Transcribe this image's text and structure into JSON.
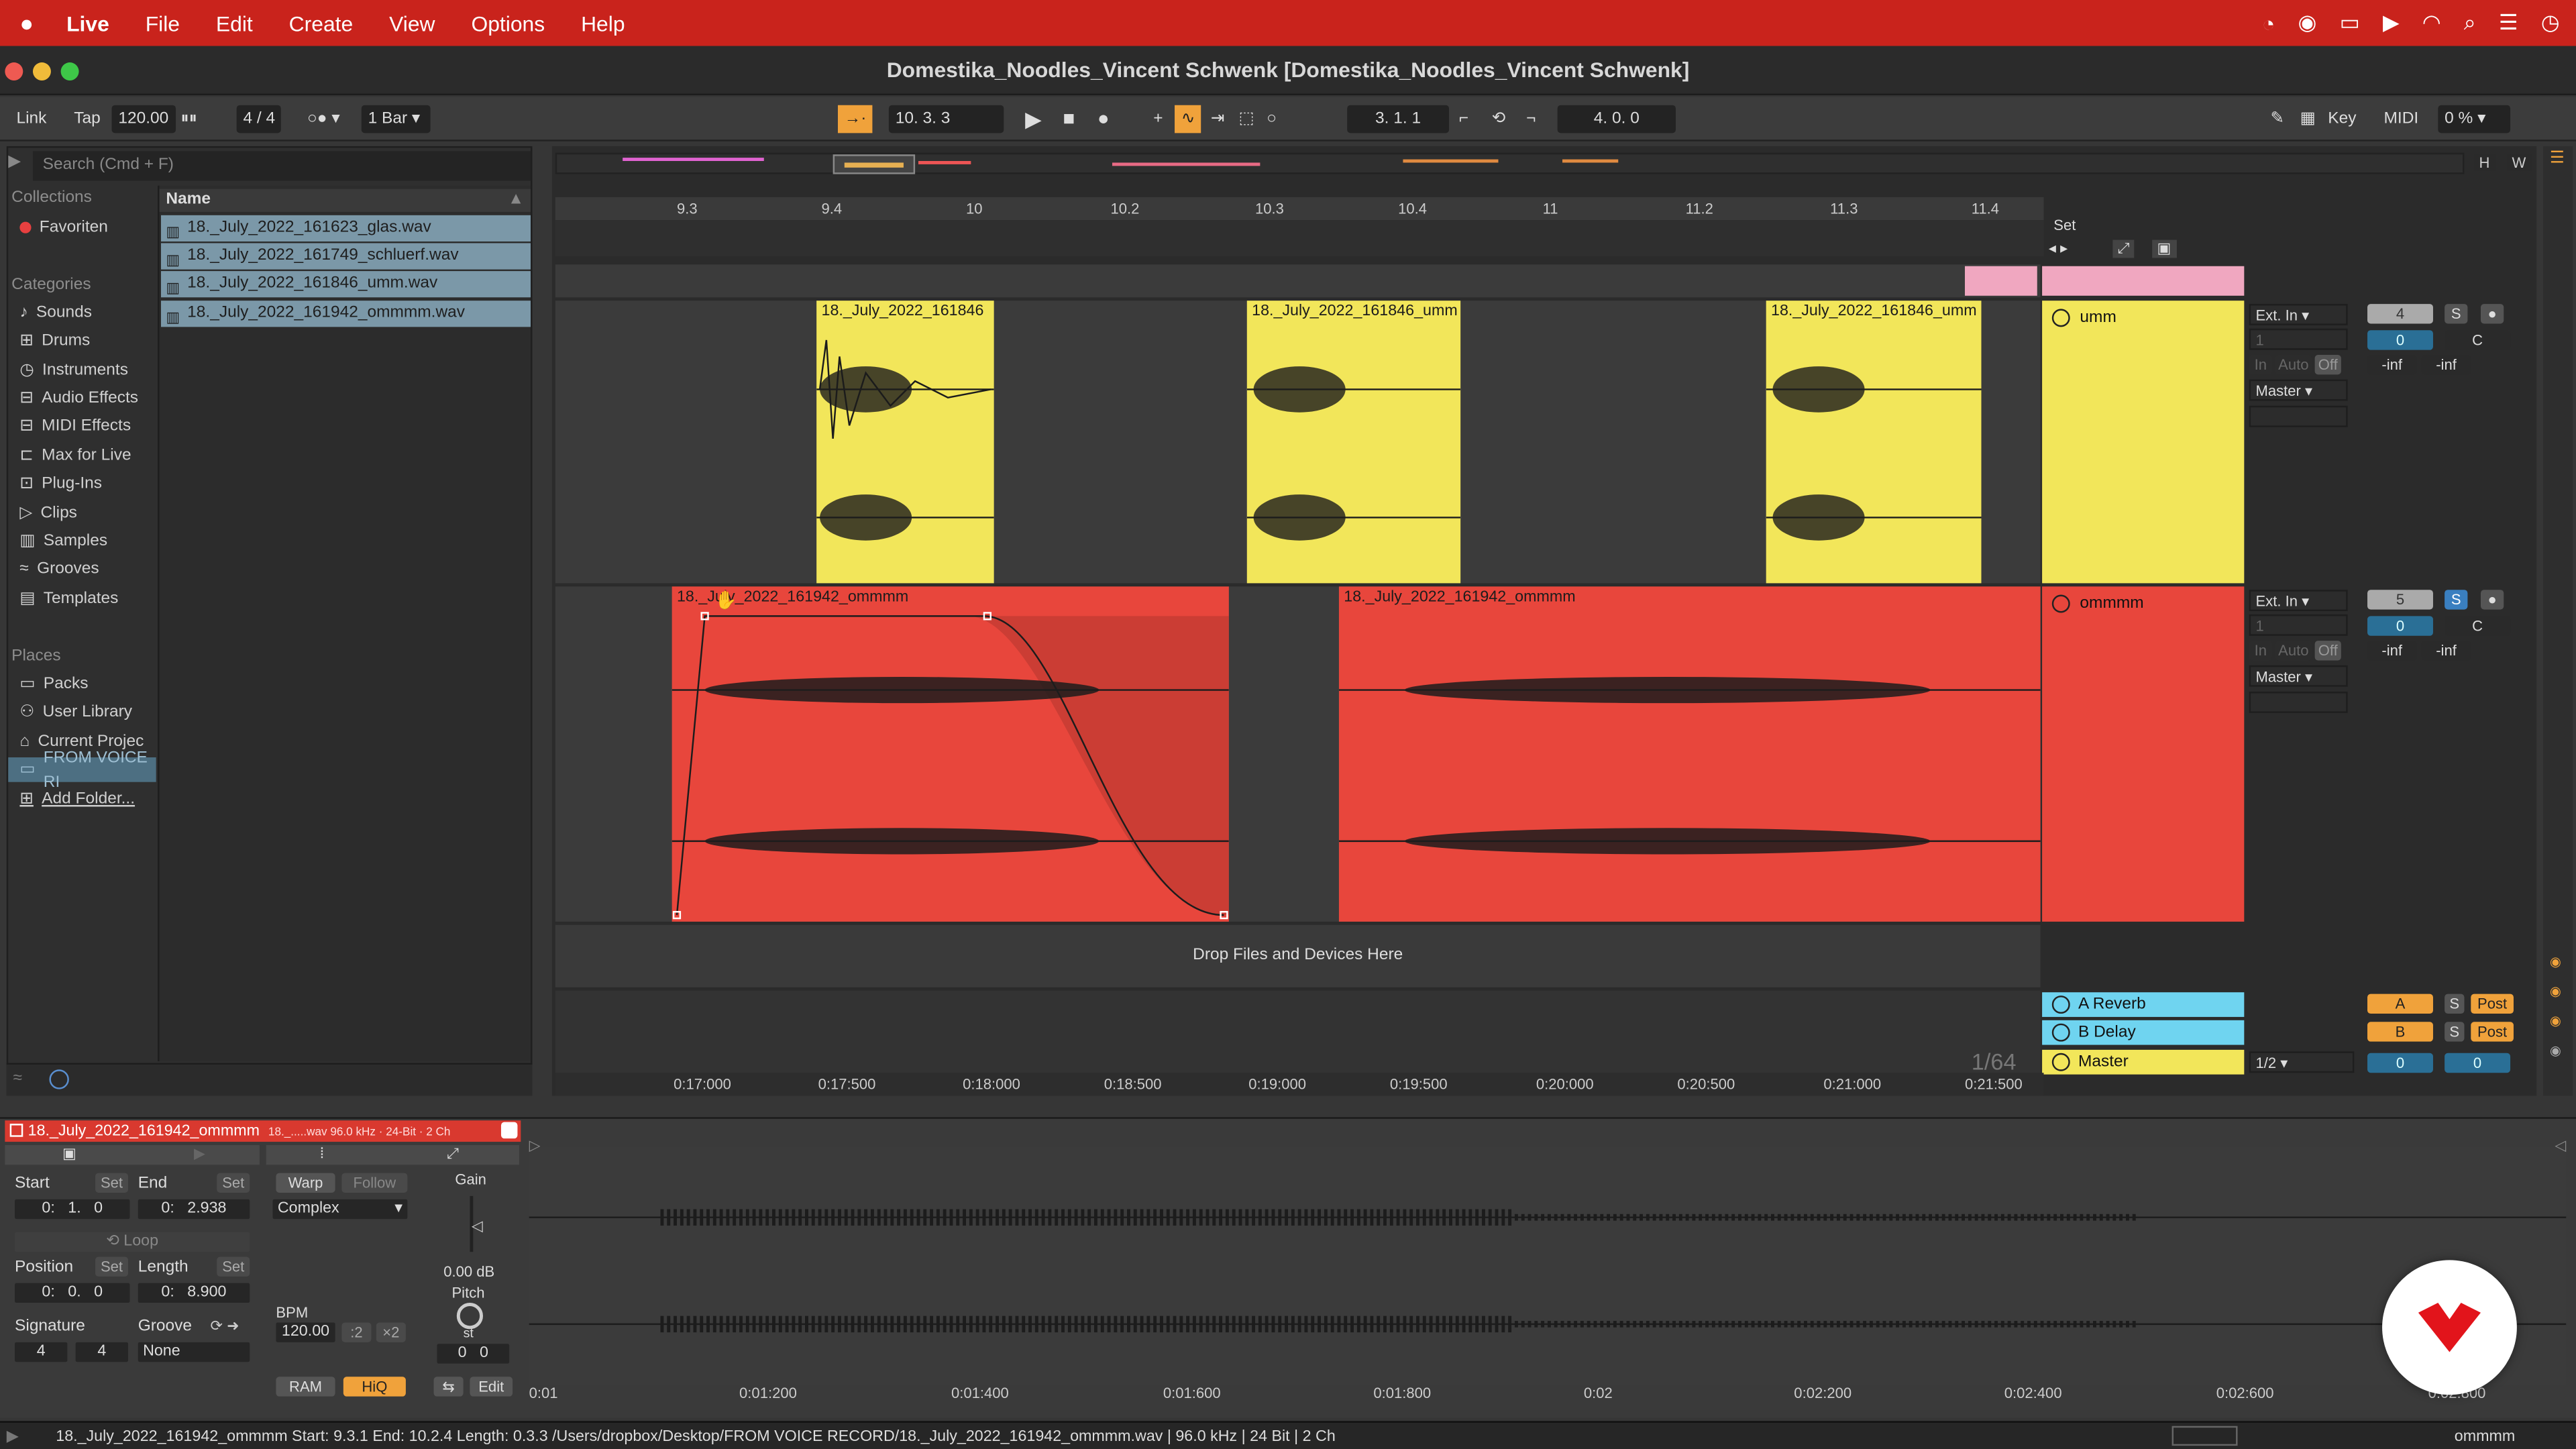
{
  "menubar": {
    "items": [
      "Live",
      "File",
      "Edit",
      "Create",
      "View",
      "Options",
      "Help"
    ]
  },
  "window": {
    "title": "Domestika_Noodles_Vincent Schwenk  [Domestika_Noodles_Vincent Schwenk]"
  },
  "control": {
    "link": "Link",
    "tap": "Tap",
    "bpm": "120.00",
    "signature": "4 / 4",
    "quantize": "1 Bar",
    "position": "10.  3.  3",
    "loop_start": "3.  1.  1",
    "loop_length": "4.  0.  0",
    "key": "Key",
    "midi": "MIDI",
    "cpu": "0 %"
  },
  "browser": {
    "search_placeholder": "Search (Cmd + F)",
    "collections_label": "Collections",
    "favorites": "Favoriten",
    "categories_label": "Categories",
    "categories": [
      "Sounds",
      "Drums",
      "Instruments",
      "Audio Effects",
      "MIDI Effects",
      "Max for Live",
      "Plug-Ins",
      "Clips",
      "Samples",
      "Grooves",
      "Templates"
    ],
    "places_label": "Places",
    "places": [
      "Packs",
      "User Library",
      "Current Projec",
      "FROM VOICE RI",
      "Add Folder..."
    ],
    "name_header": "Name",
    "files": [
      "18._July_2022_161623_glas.wav",
      "18._July_2022_161749_schluerf.wav",
      "18._July_2022_161846_umm.wav",
      "18._July_2022_161942_ommmm.wav"
    ]
  },
  "arrangement": {
    "bar_ticks": [
      "9.3",
      "9.4",
      "10",
      "10.2",
      "10.3",
      "10.4",
      "11",
      "11.2",
      "11.3",
      "11.4"
    ],
    "set_label": "Set",
    "time_ticks": [
      "0:17:000",
      "0:17:500",
      "0:18:000",
      "0:18:500",
      "0:19:000",
      "0:19:500",
      "0:20:000",
      "0:20:500",
      "0:21:000",
      "0:21:500"
    ],
    "grid": "1/64",
    "drop_text": "Drop Files and Devices Here",
    "tracks": [
      {
        "name": "umm",
        "color": "#f2e65a",
        "clips": [
          "18._July_2022_161846",
          "18._July_2022_161846_umm",
          "18._July_2022_161846_umm"
        ],
        "input": "Ext. In",
        "channel": "1",
        "output": "Master",
        "number": "4",
        "solo": "S",
        "volume": "0",
        "pan": "C",
        "monitor": [
          "In",
          "Auto",
          "Off"
        ],
        "peak_left": "-inf",
        "peak_right": "-inf"
      },
      {
        "name": "ommmm",
        "color": "#e8463c",
        "clips": [
          "18._July_2022_161942_ommmm",
          "18._July_2022_161942_ommmm"
        ],
        "input": "Ext. In",
        "channel": "1",
        "output": "Master",
        "number": "5",
        "solo": "S",
        "volume": "0",
        "pan": "C",
        "monitor": [
          "In",
          "Auto",
          "Off"
        ],
        "peak_left": "-inf",
        "peak_right": "-inf"
      }
    ],
    "returns": [
      {
        "name": "A Reverb",
        "send": "A",
        "solo": "S",
        "post": "Post"
      },
      {
        "name": "B Delay",
        "send": "B",
        "solo": "S",
        "post": "Post"
      }
    ],
    "master": {
      "name": "Master",
      "cue": "1/2",
      "volume": "0",
      "pan": "0"
    },
    "side_buttons": [
      "H",
      "W"
    ]
  },
  "clip_detail": {
    "title": "18._July_2022_161942_ommmm",
    "file_info": "18._.....wav   96.0 kHz · 24-Bit · 2 Ch",
    "start_label": "Start",
    "end_label": "End",
    "set": "Set",
    "start": [
      "0:",
      "1.",
      "0"
    ],
    "end": [
      "0:",
      "2.938"
    ],
    "loop": "Loop",
    "position_label": "Position",
    "length_label": "Length",
    "position": [
      "0:",
      "0.",
      "0"
    ],
    "length": [
      "0:",
      "8.900"
    ],
    "signature_label": "Signature",
    "groove_label": "Groove",
    "sig_num": "4",
    "sig_den": "4",
    "groove": "None",
    "warp": "Warp",
    "follow": "Follow",
    "warp_mode": "Complex",
    "bpm_label": "BPM",
    "bpm": "120.00",
    "half": ":2",
    "double": "×2",
    "gain_label": "Gain",
    "gain": "0.00 dB",
    "pitch_label": "Pitch",
    "pitch_unit": "st",
    "pitch_coarse": "0",
    "pitch_fine": "0",
    "ram": "RAM",
    "hiq": "HiQ",
    "edit": "Edit",
    "sample_ticks": [
      "0:01",
      "0:01:200",
      "0:01:400",
      "0:01:600",
      "0:01:800",
      "0:02",
      "0:02:200",
      "0:02:400",
      "0:02:600",
      "0:02:800"
    ]
  },
  "status": {
    "text": "18._July_2022_161942_ommmm  Start: 9.3.1  End: 10.2.4  Length: 0.3.3  /Users/dropbox/Desktop/FROM VOICE RECORD/18._July_2022_161942_ommmm.wav | 96.0 kHz | 24 Bit | 2 Ch",
    "track": "ommmm"
  }
}
